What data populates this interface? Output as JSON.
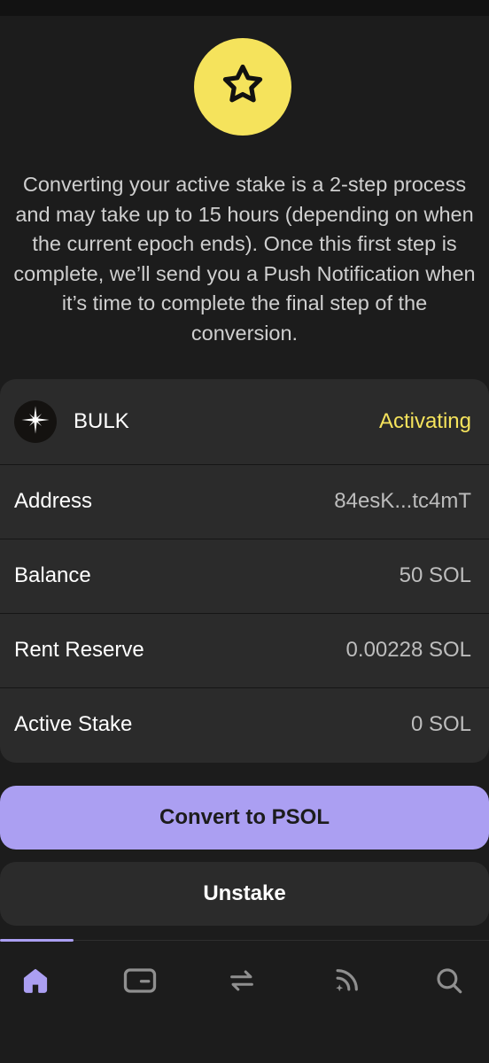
{
  "description": "Converting your active stake is a 2-step process and may take up to 15 hours (depending on when the current epoch ends). Once this first step is complete, we’ll send you a Push Notification when it’s time to complete the final step of the conversion.",
  "validator": {
    "name": "BULK",
    "status": "Activating",
    "logo_icon": "sparkle-star-icon"
  },
  "details": [
    {
      "label": "Address",
      "value": "84esK...tc4mT"
    },
    {
      "label": "Balance",
      "value": "50 SOL"
    },
    {
      "label": "Rent Reserve",
      "value": "0.00228 SOL"
    },
    {
      "label": "Active Stake",
      "value": "0 SOL"
    }
  ],
  "actions": {
    "convert_label": "Convert to PSOL",
    "unstake_label": "Unstake"
  },
  "tabs": [
    {
      "icon": "home-icon",
      "active": true
    },
    {
      "icon": "wallet-card-icon",
      "active": false
    },
    {
      "icon": "swap-icon",
      "active": false
    },
    {
      "icon": "activity-feed-icon",
      "active": false
    },
    {
      "icon": "search-icon",
      "active": false
    }
  ],
  "colors": {
    "background": "#1c1c1c",
    "card": "#2b2b2b",
    "accent_purple": "#ab9ff2",
    "accent_yellow": "#f5e35c"
  }
}
